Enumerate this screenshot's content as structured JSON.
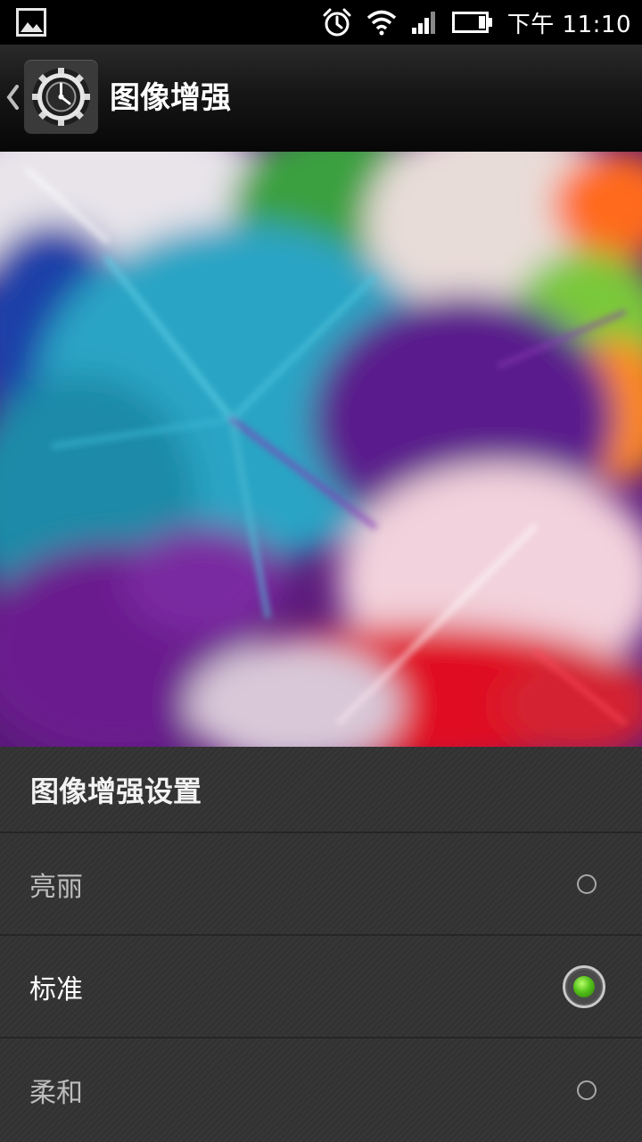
{
  "status_bar": {
    "time": "下午 11:10",
    "icons": [
      "picture-notification-icon",
      "alarm-icon",
      "wifi-icon",
      "signal-icon",
      "battery-icon"
    ]
  },
  "action_bar": {
    "title": "图像增强",
    "back_icon": "chevron-left-icon",
    "app_icon": "settings-gear-icon"
  },
  "preview": {
    "description_icon": "colorful-feathers-preview-image"
  },
  "settings": {
    "header": "图像增强设置",
    "options": [
      {
        "label": "亮丽",
        "selected": false
      },
      {
        "label": "标准",
        "selected": true
      },
      {
        "label": "柔和",
        "selected": false
      }
    ]
  },
  "colors": {
    "accent": "#55c21a",
    "list_bg": "#323232",
    "actionbar_bg": "#161616"
  }
}
